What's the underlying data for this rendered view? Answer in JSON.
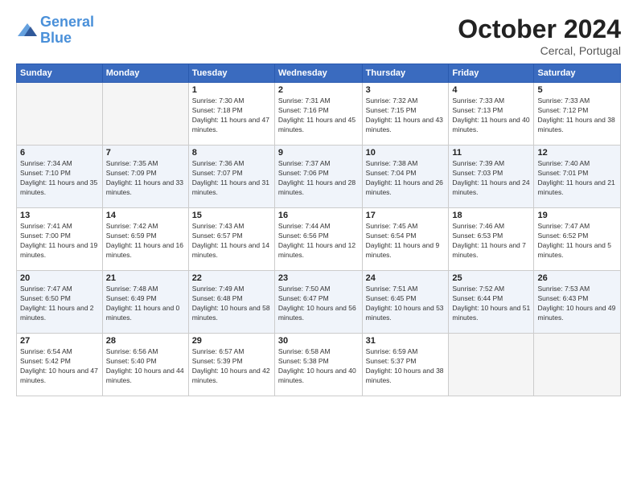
{
  "header": {
    "logo_line1": "General",
    "logo_line2": "Blue",
    "month": "October 2024",
    "location": "Cercal, Portugal"
  },
  "days_of_week": [
    "Sunday",
    "Monday",
    "Tuesday",
    "Wednesday",
    "Thursday",
    "Friday",
    "Saturday"
  ],
  "weeks": [
    [
      {
        "num": "",
        "info": ""
      },
      {
        "num": "",
        "info": ""
      },
      {
        "num": "1",
        "info": "Sunrise: 7:30 AM\nSunset: 7:18 PM\nDaylight: 11 hours and 47 minutes."
      },
      {
        "num": "2",
        "info": "Sunrise: 7:31 AM\nSunset: 7:16 PM\nDaylight: 11 hours and 45 minutes."
      },
      {
        "num": "3",
        "info": "Sunrise: 7:32 AM\nSunset: 7:15 PM\nDaylight: 11 hours and 43 minutes."
      },
      {
        "num": "4",
        "info": "Sunrise: 7:33 AM\nSunset: 7:13 PM\nDaylight: 11 hours and 40 minutes."
      },
      {
        "num": "5",
        "info": "Sunrise: 7:33 AM\nSunset: 7:12 PM\nDaylight: 11 hours and 38 minutes."
      }
    ],
    [
      {
        "num": "6",
        "info": "Sunrise: 7:34 AM\nSunset: 7:10 PM\nDaylight: 11 hours and 35 minutes."
      },
      {
        "num": "7",
        "info": "Sunrise: 7:35 AM\nSunset: 7:09 PM\nDaylight: 11 hours and 33 minutes."
      },
      {
        "num": "8",
        "info": "Sunrise: 7:36 AM\nSunset: 7:07 PM\nDaylight: 11 hours and 31 minutes."
      },
      {
        "num": "9",
        "info": "Sunrise: 7:37 AM\nSunset: 7:06 PM\nDaylight: 11 hours and 28 minutes."
      },
      {
        "num": "10",
        "info": "Sunrise: 7:38 AM\nSunset: 7:04 PM\nDaylight: 11 hours and 26 minutes."
      },
      {
        "num": "11",
        "info": "Sunrise: 7:39 AM\nSunset: 7:03 PM\nDaylight: 11 hours and 24 minutes."
      },
      {
        "num": "12",
        "info": "Sunrise: 7:40 AM\nSunset: 7:01 PM\nDaylight: 11 hours and 21 minutes."
      }
    ],
    [
      {
        "num": "13",
        "info": "Sunrise: 7:41 AM\nSunset: 7:00 PM\nDaylight: 11 hours and 19 minutes."
      },
      {
        "num": "14",
        "info": "Sunrise: 7:42 AM\nSunset: 6:59 PM\nDaylight: 11 hours and 16 minutes."
      },
      {
        "num": "15",
        "info": "Sunrise: 7:43 AM\nSunset: 6:57 PM\nDaylight: 11 hours and 14 minutes."
      },
      {
        "num": "16",
        "info": "Sunrise: 7:44 AM\nSunset: 6:56 PM\nDaylight: 11 hours and 12 minutes."
      },
      {
        "num": "17",
        "info": "Sunrise: 7:45 AM\nSunset: 6:54 PM\nDaylight: 11 hours and 9 minutes."
      },
      {
        "num": "18",
        "info": "Sunrise: 7:46 AM\nSunset: 6:53 PM\nDaylight: 11 hours and 7 minutes."
      },
      {
        "num": "19",
        "info": "Sunrise: 7:47 AM\nSunset: 6:52 PM\nDaylight: 11 hours and 5 minutes."
      }
    ],
    [
      {
        "num": "20",
        "info": "Sunrise: 7:47 AM\nSunset: 6:50 PM\nDaylight: 11 hours and 2 minutes."
      },
      {
        "num": "21",
        "info": "Sunrise: 7:48 AM\nSunset: 6:49 PM\nDaylight: 11 hours and 0 minutes."
      },
      {
        "num": "22",
        "info": "Sunrise: 7:49 AM\nSunset: 6:48 PM\nDaylight: 10 hours and 58 minutes."
      },
      {
        "num": "23",
        "info": "Sunrise: 7:50 AM\nSunset: 6:47 PM\nDaylight: 10 hours and 56 minutes."
      },
      {
        "num": "24",
        "info": "Sunrise: 7:51 AM\nSunset: 6:45 PM\nDaylight: 10 hours and 53 minutes."
      },
      {
        "num": "25",
        "info": "Sunrise: 7:52 AM\nSunset: 6:44 PM\nDaylight: 10 hours and 51 minutes."
      },
      {
        "num": "26",
        "info": "Sunrise: 7:53 AM\nSunset: 6:43 PM\nDaylight: 10 hours and 49 minutes."
      }
    ],
    [
      {
        "num": "27",
        "info": "Sunrise: 6:54 AM\nSunset: 5:42 PM\nDaylight: 10 hours and 47 minutes."
      },
      {
        "num": "28",
        "info": "Sunrise: 6:56 AM\nSunset: 5:40 PM\nDaylight: 10 hours and 44 minutes."
      },
      {
        "num": "29",
        "info": "Sunrise: 6:57 AM\nSunset: 5:39 PM\nDaylight: 10 hours and 42 minutes."
      },
      {
        "num": "30",
        "info": "Sunrise: 6:58 AM\nSunset: 5:38 PM\nDaylight: 10 hours and 40 minutes."
      },
      {
        "num": "31",
        "info": "Sunrise: 6:59 AM\nSunset: 5:37 PM\nDaylight: 10 hours and 38 minutes."
      },
      {
        "num": "",
        "info": ""
      },
      {
        "num": "",
        "info": ""
      }
    ]
  ]
}
